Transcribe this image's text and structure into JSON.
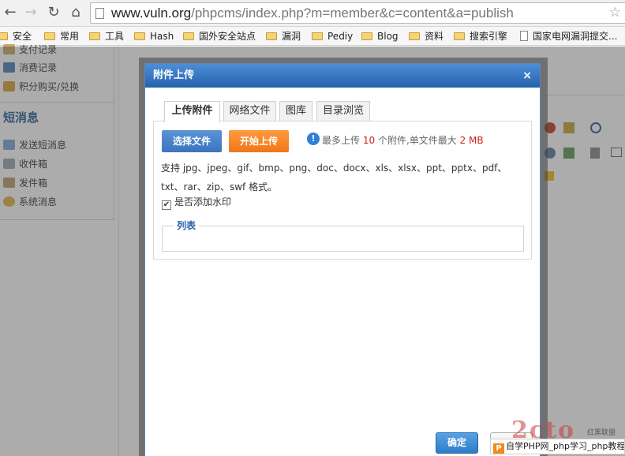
{
  "browser": {
    "url_host": "www.vuln.org",
    "url_path": "/phpcms/index.php?m=member&c=content&a=publish",
    "bookmarks": [
      "安全",
      "常用",
      "工具",
      "Hash",
      "国外安全站点",
      "漏洞",
      "Pediy",
      "Blog",
      "资料",
      "搜索引擎",
      "国家电网漏洞提交..."
    ]
  },
  "sidebar": {
    "items_top": [
      "支付记录",
      "消费记录",
      "积分购买/兑换"
    ],
    "heading": "短消息",
    "items_msg": [
      "发送短消息",
      "收件箱",
      "发件箱",
      "系统消息"
    ]
  },
  "dialog": {
    "title": "附件上传",
    "close": "×",
    "tabs": [
      "上传附件",
      "网络文件",
      "图库",
      "目录浏览"
    ],
    "select_button": "选择文件",
    "start_button": "开始上传",
    "limit_prefix": "最多上传",
    "limit_count": "10",
    "limit_mid": "个附件,单文件最大",
    "limit_size": "2 MB",
    "types_text": "支持 jpg、jpeg、gif、bmp、png、doc、docx、xls、xlsx、ppt、pptx、pdf、txt、rar、zip、swf 格式。",
    "watermark_label": "是否添加水印",
    "watermark_checked": true,
    "list_legend": "列表",
    "ok_button": "确定"
  },
  "watermark": {
    "logo": "2cto",
    "small": "红黑联盟",
    "strip": "自学PHP网_php学习_php教程"
  }
}
